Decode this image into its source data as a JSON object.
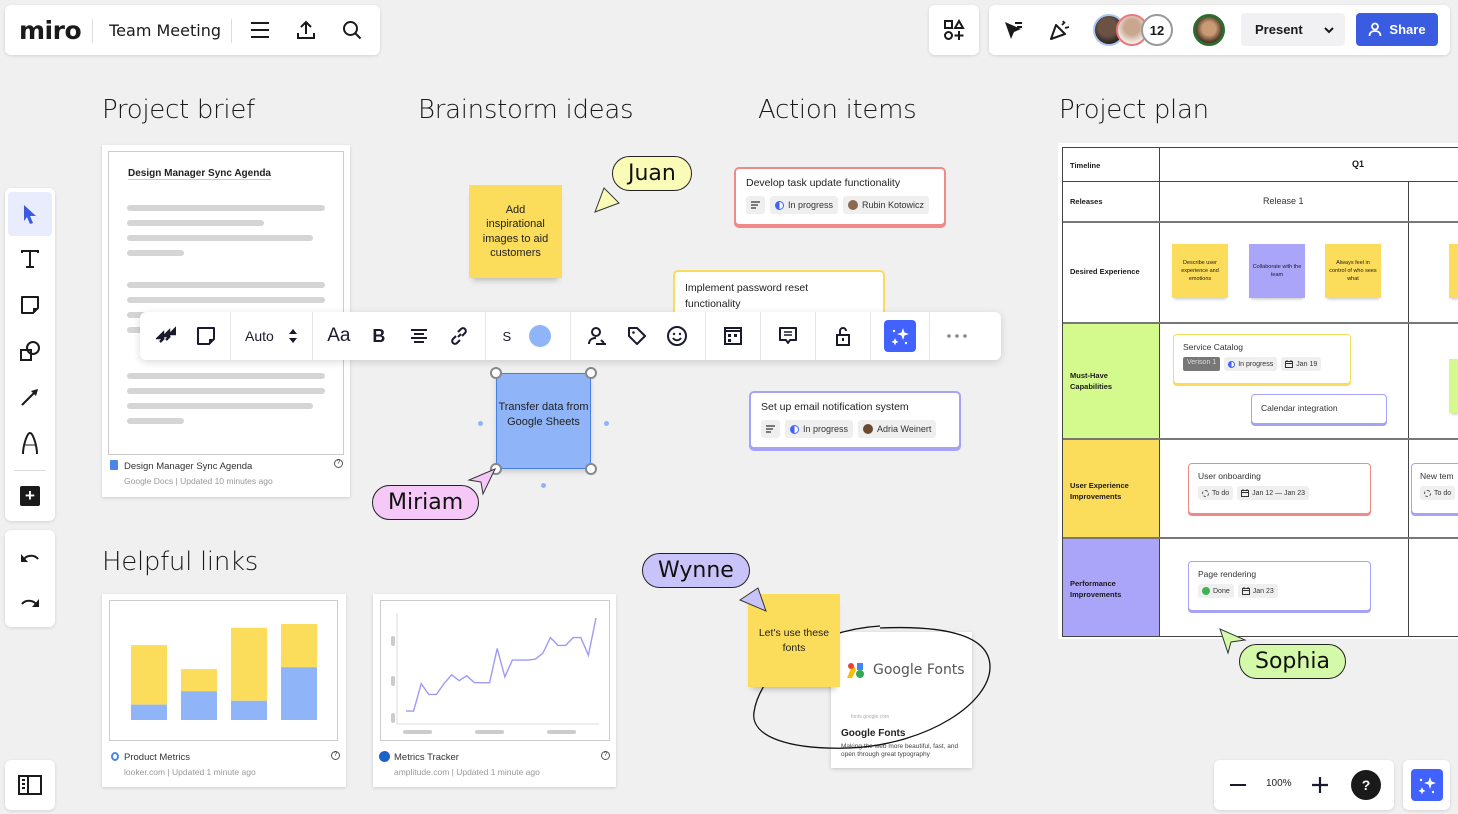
{
  "topbar": {
    "logo": "miro",
    "board_name": "Team Meeting",
    "menu_icon": "hamburger-menu-icon",
    "export_icon": "upload-icon",
    "search_icon": "search-icon"
  },
  "collab": {
    "shapes_icon": "shapes-plus-icon",
    "cursor_filter_icon": "cursor-filter-icon",
    "reactions_icon": "party-popper-icon",
    "participant_count": "12",
    "present_label": "Present",
    "share_label": "Share"
  },
  "colors": {
    "accent": "#4262ff",
    "sticky_yellow": "#fbdc5b",
    "sticky_purple": "#aaa5f8",
    "sticky_green": "#d4f98c",
    "shape_blue": "#8fb4f8",
    "card_red": "#f08a87",
    "card_yellow": "#f9dc5c",
    "card_purple": "#a6a2f7"
  },
  "left_toolbar": {
    "tools": [
      "select",
      "text",
      "sticky-note",
      "shapes",
      "connector-arrow",
      "pen"
    ],
    "add_label": "+"
  },
  "sections": {
    "project_brief": "Project brief",
    "brainstorm": "Brainstorm ideas",
    "action_items": "Action items",
    "project_plan": "Project plan",
    "helpful_links": "Helpful links"
  },
  "brief_doc": {
    "heading": "Design Manager Sync Agenda",
    "title": "Design Manager Sync Agenda",
    "source": "Google Docs",
    "updated": "Updated 10 minutes ago"
  },
  "stickies": {
    "inspiration": "Add inspirational images to aid customers",
    "transfer": "Transfer data from Google Sheets",
    "fonts": "Let's use these fonts"
  },
  "cursors": {
    "juan": "Juan",
    "miriam": "Miriam",
    "wynne": "Wynne",
    "sophia": "Sophia"
  },
  "action_cards": [
    {
      "title": "Develop task update functionality",
      "status": "In progress",
      "assignee": "Rubin Kotowicz"
    },
    {
      "title": "Implement password reset functionality"
    },
    {
      "title": "Set up email notification system",
      "status": "In progress",
      "assignee": "Adria Weinert"
    }
  ],
  "context_toolbar": {
    "size_label": "Auto",
    "font_label": "Aa",
    "bold_label": "B",
    "size_s_label": "S",
    "color": "#8fb4f8"
  },
  "links": [
    {
      "title": "Product Metrics",
      "source": "looker.com",
      "updated": "Updated 1 minute ago"
    },
    {
      "title": "Metrics Tracker",
      "source": "amplitude.com",
      "updated": "Updated 1 minute ago"
    }
  ],
  "google_fonts": {
    "logo_text": "Google Fonts",
    "domain": "fonts.google.com",
    "title": "Google Fonts",
    "description": "Making the web more beautiful, fast, and open through great typography"
  },
  "plan": {
    "timeline_label": "Timeline",
    "quarter": "Q1",
    "releases_label": "Releases",
    "release1": "Release 1",
    "rows": {
      "desired": "Desired Experience",
      "must_have": "Must-Have Capabilities",
      "ux": "User Experience Improvements",
      "perf": "Performance Improvements"
    },
    "desired_stickies": [
      "Describe user experience and emotions",
      "Collaborate with the team",
      "Always feel in control of who sees what"
    ],
    "service_catalog": {
      "title": "Service Catalog",
      "tag": "Verison 1",
      "status": "In progress",
      "date": "Jan 19"
    },
    "calendar": {
      "title": "Calendar integration"
    },
    "onboarding": {
      "title": "User onboarding",
      "status": "To do",
      "date": "Jan 12 — Jan 23"
    },
    "new_template": {
      "title": "New tem",
      "status": "To do"
    },
    "page_rendering": {
      "title": "Page rendering",
      "status": "Done",
      "date": "Jan 23"
    }
  },
  "zoom": {
    "level": "100%",
    "help": "?"
  }
}
